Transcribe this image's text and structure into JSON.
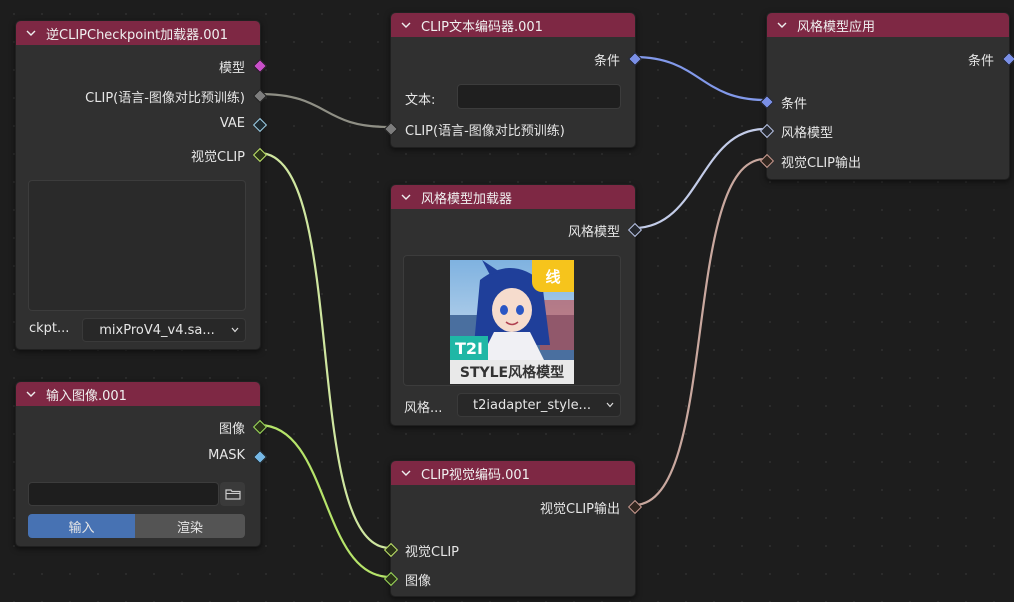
{
  "nodes": {
    "checkpoint_loader": {
      "title": "逆CLIPCheckpoint加载器.001",
      "outputs": [
        "模型",
        "CLIP(语言-图像对比预训练)",
        "VAE",
        "视觉CLIP"
      ],
      "ckpt_label": "ckpt...",
      "ckpt_value": "mixProV4_v4.sa..."
    },
    "load_image": {
      "title": "输入图像.001",
      "outputs": [
        "图像",
        "MASK"
      ],
      "path_value": "",
      "tab_input": "输入",
      "tab_render": "渲染"
    },
    "clip_text_encoder": {
      "title": "CLIP文本编码器.001",
      "output": "条件",
      "text_label": "文本:",
      "text_value": "",
      "input": "CLIP(语言-图像对比预训练)"
    },
    "style_model_loader": {
      "title": "风格模型加载器",
      "output": "风格模型",
      "preview_badge_top": "线",
      "preview_badge_bottom": "T2I",
      "preview_caption": "STYLE风格模型",
      "model_label": "风格...",
      "model_value": "t2iadapter_style..."
    },
    "clip_vision_encode": {
      "title": "CLIP视觉编码.001",
      "output": "视觉CLIP输出",
      "inputs": [
        "视觉CLIP",
        "图像"
      ]
    },
    "apply_style_model": {
      "title": "风格模型应用",
      "output": "条件",
      "inputs": [
        "条件",
        "风格模型",
        "视觉CLIP输出"
      ]
    }
  },
  "colors": {
    "header": "#7e2844",
    "node_body": "#303030",
    "model_socket": "#c94fc9",
    "clip_socket": "#7d7d7d",
    "vae_socket": "#9fd0e8",
    "clip_vision_socket": "#c0e56b",
    "image_socket": "#9edb5b",
    "mask_socket": "#76b8e6",
    "conditioning_socket": "#7a8fe6",
    "style_model_socket": "#b9c4e6",
    "clip_vision_output_socket": "#c89a90",
    "tab_active": "#4772b3"
  }
}
